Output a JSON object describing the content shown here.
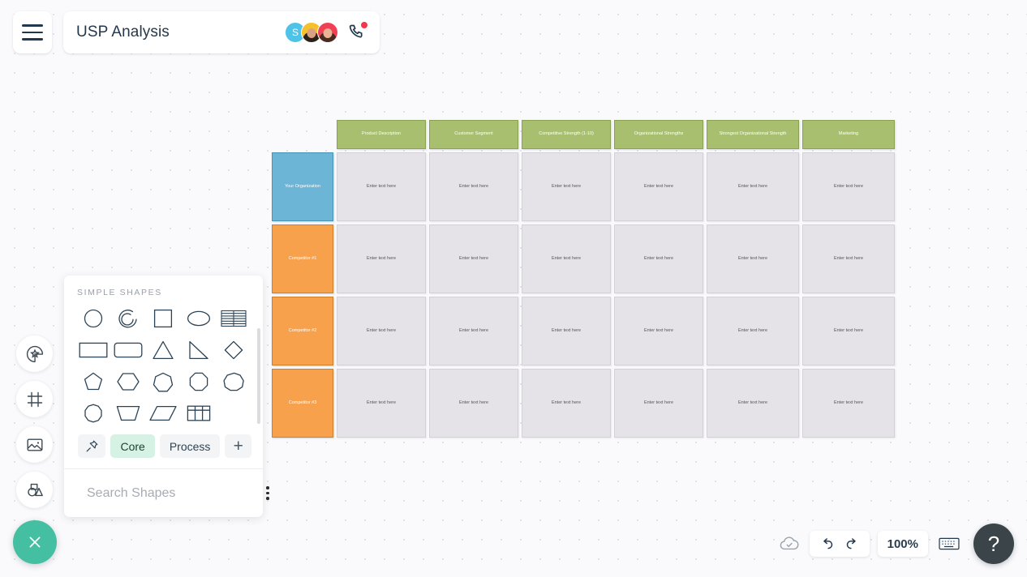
{
  "header": {
    "menu_icon": "hamburger-menu-icon",
    "title": "USP Analysis",
    "avatars": [
      {
        "initial": "S",
        "color": "#4ec3e8",
        "type": "initial"
      },
      {
        "initial": "",
        "color": "#f5c02c",
        "type": "photo"
      },
      {
        "initial": "",
        "color": "#ef4056",
        "type": "photo"
      }
    ],
    "phone_icon": "phone-call-icon",
    "notification_color": "#f4354a"
  },
  "rail": {
    "items": [
      {
        "name": "sticker-icon",
        "label": "Stickers"
      },
      {
        "name": "frame-icon",
        "label": "Frame"
      },
      {
        "name": "image-icon",
        "label": "Image"
      },
      {
        "name": "shapes-icon",
        "label": "Shapes"
      }
    ]
  },
  "shapes_panel": {
    "section_title": "SIMPLE SHAPES",
    "shapes": [
      {
        "name": "circle-shape",
        "glyph": "circle"
      },
      {
        "name": "arc-shape",
        "glyph": "arc"
      },
      {
        "name": "square-shape",
        "glyph": "square"
      },
      {
        "name": "ellipse-shape",
        "glyph": "ellipse"
      },
      {
        "name": "striped-table-shape",
        "glyph": "striped-table"
      },
      {
        "name": "rectangle-shape",
        "glyph": "rectangle"
      },
      {
        "name": "rounded-rectangle-shape",
        "glyph": "rounded-rectangle"
      },
      {
        "name": "triangle-shape",
        "glyph": "triangle"
      },
      {
        "name": "right-triangle-shape",
        "glyph": "right-triangle"
      },
      {
        "name": "diamond-shape",
        "glyph": "diamond"
      },
      {
        "name": "pentagon-shape",
        "glyph": "pentagon"
      },
      {
        "name": "hexagon-shape",
        "glyph": "hexagon"
      },
      {
        "name": "heptagon-shape",
        "glyph": "heptagon"
      },
      {
        "name": "octagon-shape",
        "glyph": "octagon"
      },
      {
        "name": "nonagon-shape",
        "glyph": "nonagon"
      },
      {
        "name": "decagon-shape",
        "glyph": "decagon"
      },
      {
        "name": "trapezoid-shape",
        "glyph": "trapezoid"
      },
      {
        "name": "parallelogram-shape",
        "glyph": "parallelogram"
      },
      {
        "name": "grid-table-shape",
        "glyph": "grid-table"
      }
    ],
    "tabs": [
      {
        "label": "",
        "name": "pin-tab",
        "icon": "pin-icon",
        "active": false
      },
      {
        "label": "Core",
        "name": "core-tab",
        "active": true
      },
      {
        "label": "Process",
        "name": "process-tab",
        "active": false
      },
      {
        "label": "+",
        "name": "add-tab",
        "active": false
      }
    ],
    "search_placeholder": "Search Shapes",
    "search_value": "",
    "active_tab_color": "#d6f2e4"
  },
  "matrix": {
    "column_headers": [
      "Product Description",
      "Customer Segment",
      "Competitive Strength (1-10)",
      "Organizational Strengths",
      "Strongest Organizational Strength",
      "Marketing"
    ],
    "rows": [
      {
        "label": "Your Organization",
        "type": "organization",
        "color": "#6cb5d6"
      },
      {
        "label": "Competitor #1",
        "type": "competitor",
        "color": "#f7a14c"
      },
      {
        "label": "Competitor #2",
        "type": "competitor",
        "color": "#f7a14c"
      },
      {
        "label": "Competitor #3",
        "type": "competitor",
        "color": "#f7a14c"
      }
    ],
    "cell_placeholder": "Enter text here",
    "header_color": "#a9bf70",
    "cell_color": "#e6e3e8"
  },
  "bottombar": {
    "cloud_icon": "cloud-saved-icon",
    "undo_icon": "undo-icon",
    "redo_icon": "redo-icon",
    "zoom_level": "100%",
    "keyboard_icon": "keyboard-icon",
    "help_label": "?"
  },
  "close_fab": {
    "icon": "close-x-icon",
    "color": "#45bfa2"
  }
}
